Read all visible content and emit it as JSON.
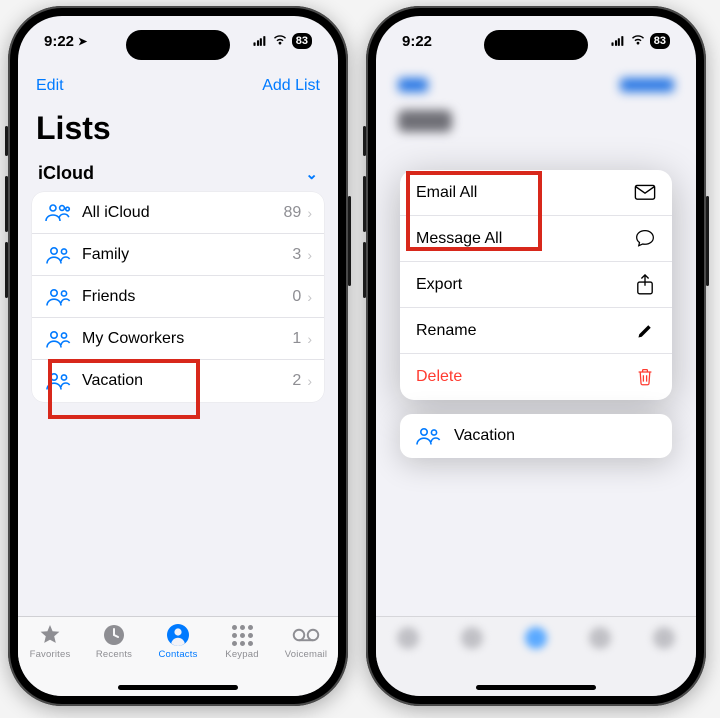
{
  "status": {
    "time": "9:22",
    "battery": "83"
  },
  "screen1": {
    "nav": {
      "edit": "Edit",
      "add": "Add List"
    },
    "title": "Lists",
    "section": {
      "name": "iCloud"
    },
    "rows": [
      {
        "label": "All iCloud",
        "count": "89"
      },
      {
        "label": "Family",
        "count": "3"
      },
      {
        "label": "Friends",
        "count": "0"
      },
      {
        "label": "My Coworkers",
        "count": "1"
      },
      {
        "label": "Vacation",
        "count": "2"
      }
    ],
    "tabs": {
      "favorites": "Favorites",
      "recents": "Recents",
      "contacts": "Contacts",
      "keypad": "Keypad",
      "voicemail": "Voicemail"
    }
  },
  "screen2": {
    "menu": {
      "email": "Email All",
      "message": "Message All",
      "export": "Export",
      "rename": "Rename",
      "delete": "Delete"
    },
    "selected": "Vacation"
  }
}
